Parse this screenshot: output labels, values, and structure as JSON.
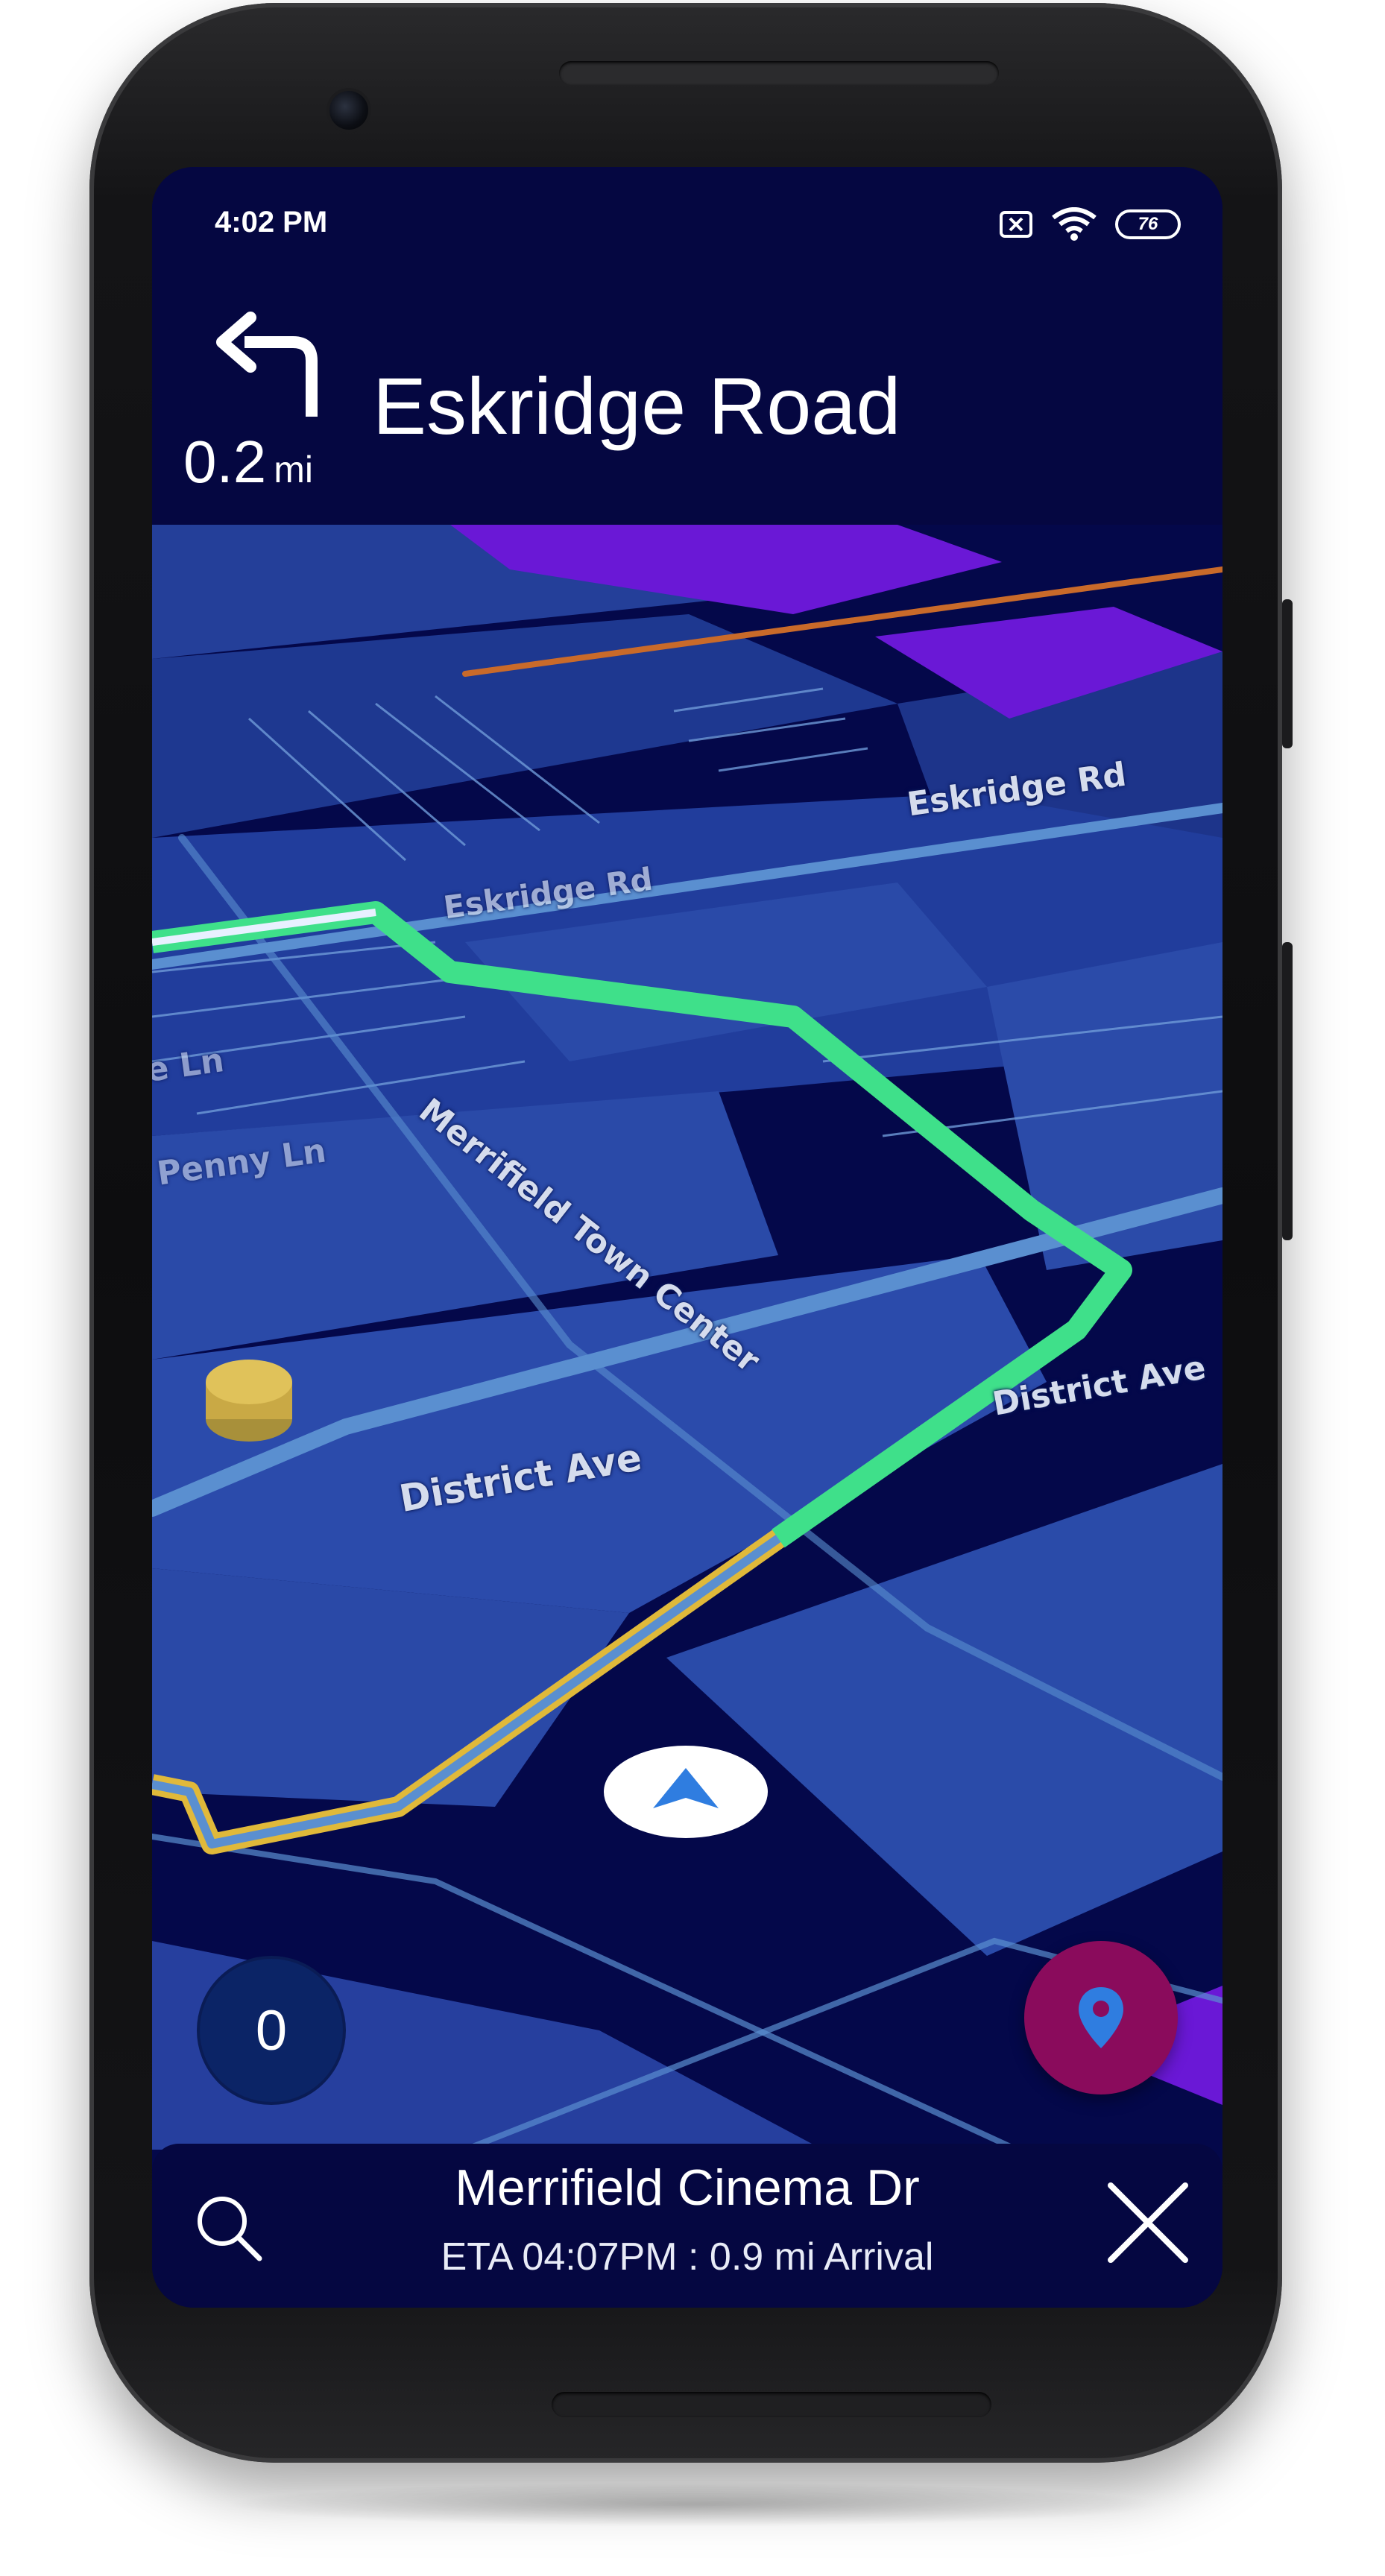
{
  "status_bar": {
    "time": "4:02 PM",
    "battery_level": "76",
    "icons": [
      "sim-error-icon",
      "wifi-icon",
      "battery-icon"
    ]
  },
  "navigation": {
    "turn_icon": "turn-left-arrow-icon",
    "distance_value": "0.2",
    "distance_unit": "mi",
    "next_street": "Eskridge Road"
  },
  "map": {
    "labels": {
      "eskridge_rd_right": "Eskridge Rd",
      "eskridge_rd_left": "Eskridge Rd",
      "merrifield_town_center": "Merrifield Town Center",
      "lane_partial": "e Ln",
      "penny_ln": "Penny Ln",
      "district_ave_left": "District Ave",
      "district_ave_right": "District Ave"
    },
    "colors": {
      "background": "#04084a",
      "block": "#2a4aa8",
      "road": "#5a8fd0",
      "route_active": "#3fe08a",
      "route_remaining": "#e0b93a",
      "parking": "#6a18d6"
    }
  },
  "controls": {
    "compass_label": "0",
    "location_icon": "location-pin-icon"
  },
  "bottom_bar": {
    "destination": "Merrifield Cinema Dr",
    "eta": "ETA 04:07PM : 0.9 mi Arrival",
    "search_icon": "search-icon",
    "close_icon": "close-icon"
  }
}
